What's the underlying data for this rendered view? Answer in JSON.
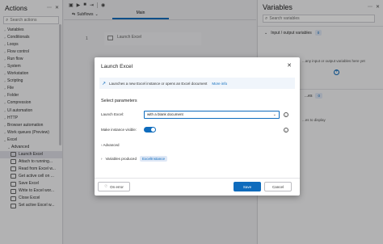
{
  "actions_panel": {
    "title": "Actions",
    "search_placeholder": "Search actions",
    "items": [
      {
        "label": "Variables",
        "type": "group"
      },
      {
        "label": "Conditionals",
        "type": "group"
      },
      {
        "label": "Loops",
        "type": "group"
      },
      {
        "label": "Flow control",
        "type": "group"
      },
      {
        "label": "Run flow",
        "type": "group"
      },
      {
        "label": "System",
        "type": "group"
      },
      {
        "label": "Workstation",
        "type": "group"
      },
      {
        "label": "Scripting",
        "type": "group"
      },
      {
        "label": "File",
        "type": "group"
      },
      {
        "label": "Folder",
        "type": "group"
      },
      {
        "label": "Compression",
        "type": "group"
      },
      {
        "label": "UI automation",
        "type": "group"
      },
      {
        "label": "HTTP",
        "type": "group"
      },
      {
        "label": "Browser automation",
        "type": "group"
      },
      {
        "label": "Work queues (Preview)",
        "type": "group"
      },
      {
        "label": "Excel",
        "type": "open"
      },
      {
        "label": "Advanced",
        "type": "sub"
      },
      {
        "label": "Launch Excel",
        "type": "leaf",
        "selected": true
      },
      {
        "label": "Attach to running...",
        "type": "leaf"
      },
      {
        "label": "Read from Excel w...",
        "type": "leaf"
      },
      {
        "label": "Get active cell on ...",
        "type": "leaf"
      },
      {
        "label": "Save Excel",
        "type": "leaf"
      },
      {
        "label": "Write to Excel wor...",
        "type": "leaf"
      },
      {
        "label": "Close Excel",
        "type": "leaf"
      },
      {
        "label": "Set active Excel w...",
        "type": "leaf"
      }
    ]
  },
  "designer": {
    "subflows_label": "Subflows",
    "main_tab": "Main",
    "row_number": "1",
    "card_label": "Launch Excel"
  },
  "variables_panel": {
    "title": "Variables",
    "search_placeholder": "Search variables",
    "io_section": "Input / output variables",
    "io_count": "0",
    "io_empty": "...any input or output variables here yet",
    "flow_section": "...es",
    "flow_count": "0",
    "flow_empty": "...es to display"
  },
  "dialog": {
    "title": "Launch Excel",
    "info_text": "Launches a new Excel instance or opens an Excel document",
    "info_link": "More info",
    "section_title": "Select parameters",
    "launch_label": "Launch Excel:",
    "launch_value": "with a blank document",
    "visible_label": "Make instance visible:",
    "visible_on": true,
    "advanced_label": "Advanced",
    "variables_produced_label": "Variables produced",
    "variable_chip": "ExcelInstance",
    "on_error_label": "On error",
    "save_label": "Save",
    "cancel_label": "Cancel",
    "accent_color": "#0f6cbd"
  }
}
